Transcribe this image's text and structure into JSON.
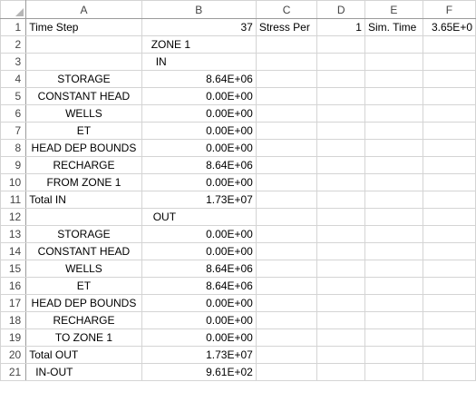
{
  "columns": [
    "A",
    "B",
    "C",
    "D",
    "E",
    "F"
  ],
  "rows": [
    {
      "num": "1",
      "a": "Time Step",
      "b": "37",
      "c": "Stress Per",
      "d": "1",
      "e": "Sim. Time",
      "f": "3.65E+0"
    },
    {
      "num": "2",
      "a": "",
      "b": "ZONE  1",
      "c": "",
      "d": "",
      "e": "",
      "f": ""
    },
    {
      "num": "3",
      "a": "",
      "b": "IN",
      "c": "",
      "d": "",
      "e": "",
      "f": ""
    },
    {
      "num": "4",
      "a": "STORAGE",
      "b": "8.64E+06",
      "c": "",
      "d": "",
      "e": "",
      "f": ""
    },
    {
      "num": "5",
      "a": "CONSTANT HEAD",
      "b": "0.00E+00",
      "c": "",
      "d": "",
      "e": "",
      "f": ""
    },
    {
      "num": "6",
      "a": "WELLS",
      "b": "0.00E+00",
      "c": "",
      "d": "",
      "e": "",
      "f": ""
    },
    {
      "num": "7",
      "a": "ET",
      "b": "0.00E+00",
      "c": "",
      "d": "",
      "e": "",
      "f": ""
    },
    {
      "num": "8",
      "a": "HEAD DEP BOUNDS",
      "b": "0.00E+00",
      "c": "",
      "d": "",
      "e": "",
      "f": ""
    },
    {
      "num": "9",
      "a": "RECHARGE",
      "b": "8.64E+06",
      "c": "",
      "d": "",
      "e": "",
      "f": ""
    },
    {
      "num": "10",
      "a": "FROM ZONE  1",
      "b": "0.00E+00",
      "c": "",
      "d": "",
      "e": "",
      "f": ""
    },
    {
      "num": "11",
      "a": "Total IN",
      "b": "1.73E+07",
      "c": "",
      "d": "",
      "e": "",
      "f": ""
    },
    {
      "num": "12",
      "a": "",
      "b": "OUT",
      "c": "",
      "d": "",
      "e": "",
      "f": ""
    },
    {
      "num": "13",
      "a": "STORAGE",
      "b": "0.00E+00",
      "c": "",
      "d": "",
      "e": "",
      "f": ""
    },
    {
      "num": "14",
      "a": "CONSTANT HEAD",
      "b": "0.00E+00",
      "c": "",
      "d": "",
      "e": "",
      "f": ""
    },
    {
      "num": "15",
      "a": "WELLS",
      "b": "8.64E+06",
      "c": "",
      "d": "",
      "e": "",
      "f": ""
    },
    {
      "num": "16",
      "a": "ET",
      "b": "8.64E+06",
      "c": "",
      "d": "",
      "e": "",
      "f": ""
    },
    {
      "num": "17",
      "a": "HEAD DEP BOUNDS",
      "b": "0.00E+00",
      "c": "",
      "d": "",
      "e": "",
      "f": ""
    },
    {
      "num": "18",
      "a": "RECHARGE",
      "b": "0.00E+00",
      "c": "",
      "d": "",
      "e": "",
      "f": ""
    },
    {
      "num": "19",
      "a": "TO ZONE  1",
      "b": "0.00E+00",
      "c": "",
      "d": "",
      "e": "",
      "f": ""
    },
    {
      "num": "20",
      "a": "Total OUT",
      "b": "1.73E+07",
      "c": "",
      "d": "",
      "e": "",
      "f": ""
    },
    {
      "num": "21",
      "a": "IN-OUT",
      "b": "9.61E+02",
      "c": "",
      "d": "",
      "e": "",
      "f": ""
    }
  ]
}
